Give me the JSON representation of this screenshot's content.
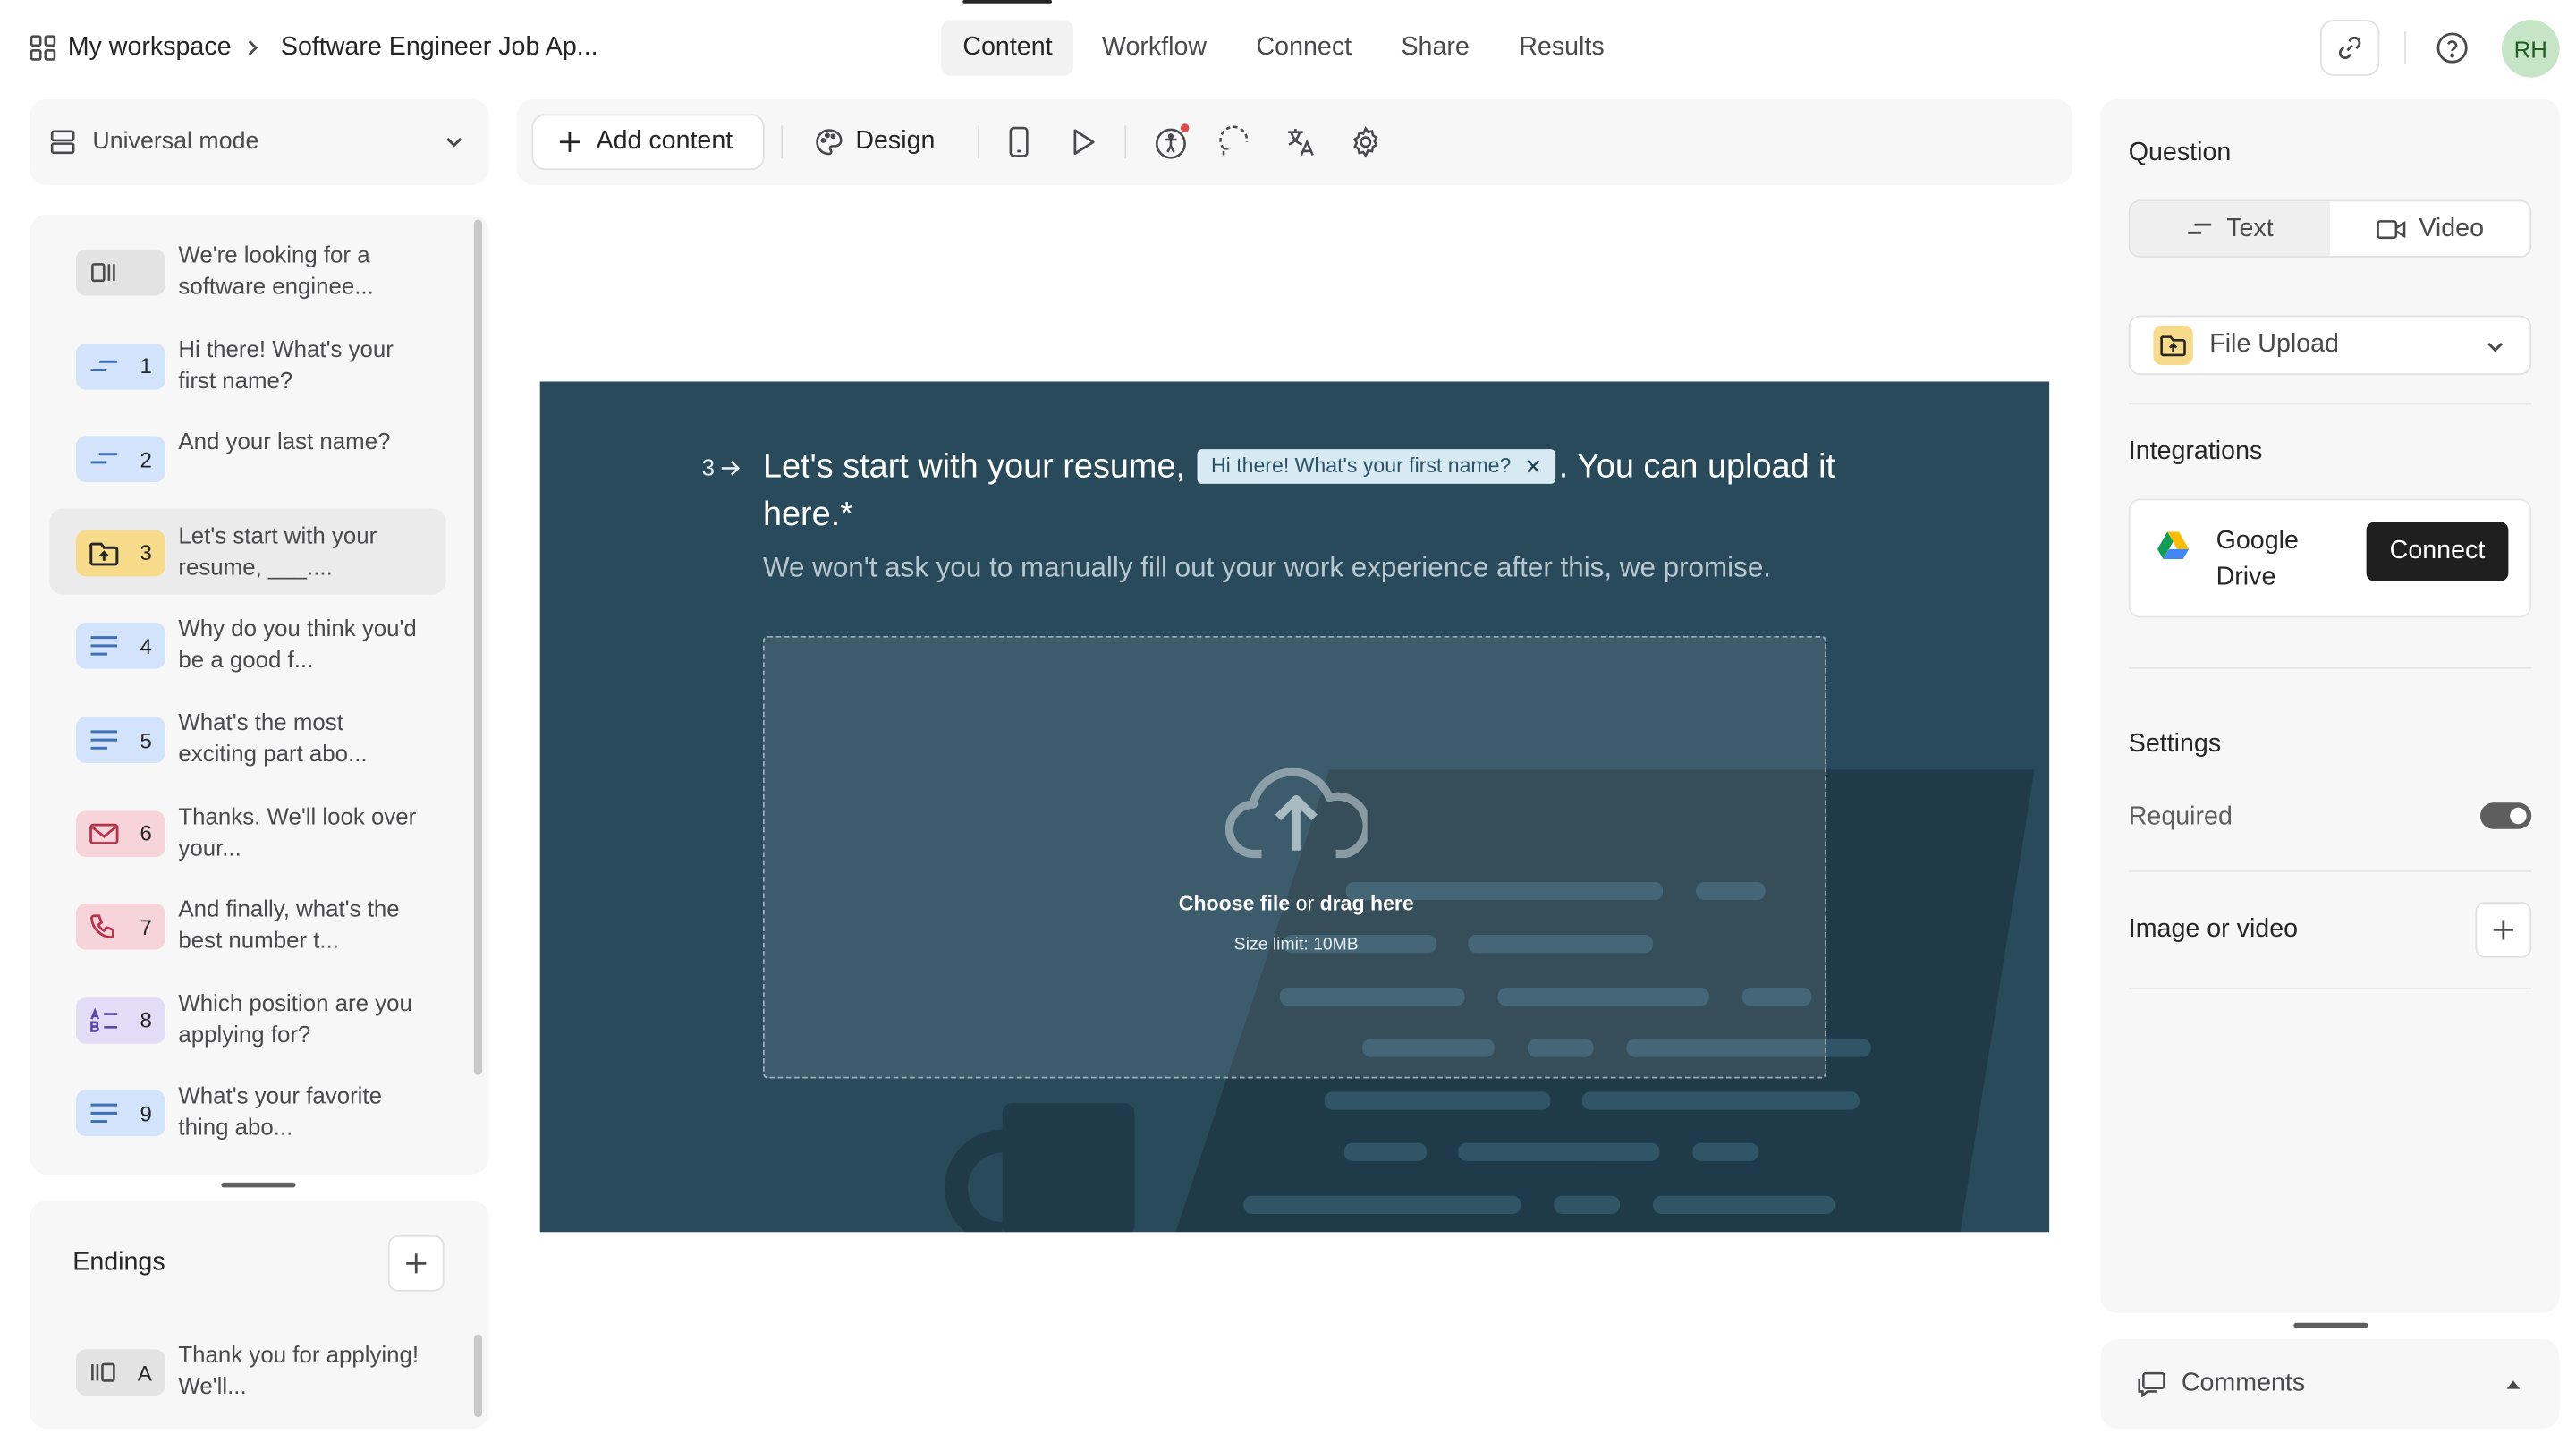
{
  "header": {
    "workspace": "My workspace",
    "form_title": "Software Engineer Job Ap...",
    "tabs": [
      {
        "label": "Content",
        "active": true
      },
      {
        "label": "Workflow",
        "active": false
      },
      {
        "label": "Connect",
        "active": false
      },
      {
        "label": "Share",
        "active": false
      },
      {
        "label": "Results",
        "active": false
      }
    ],
    "avatar_initials": "RH"
  },
  "sidebar": {
    "mode_label": "Universal mode",
    "questions": [
      {
        "num": "",
        "icon": "statement-icon",
        "color": "#e3e3e3",
        "text": "We're looking for a software enginee..."
      },
      {
        "num": "1",
        "icon": "short-text-icon",
        "color": "#d2e3fb",
        "text": "Hi there! What's your first name?"
      },
      {
        "num": "2",
        "icon": "short-text-icon",
        "color": "#d2e3fb",
        "text": "And your last name?"
      },
      {
        "num": "3",
        "icon": "file-upload-icon",
        "color": "#f7db8a",
        "text": "Let's start with your resume, ___...."
      },
      {
        "num": "4",
        "icon": "long-text-icon",
        "color": "#d2e3fb",
        "text": "Why do you think you'd be a good f..."
      },
      {
        "num": "5",
        "icon": "long-text-icon",
        "color": "#d2e3fb",
        "text": "What's the most exciting part abo..."
      },
      {
        "num": "6",
        "icon": "email-icon",
        "color": "#f6d4da",
        "text": "Thanks. We'll look over your..."
      },
      {
        "num": "7",
        "icon": "phone-icon",
        "color": "#f6d4da",
        "text": "And finally, what's the best number t..."
      },
      {
        "num": "8",
        "icon": "multiple-choice-icon",
        "color": "#e3dcf7",
        "text": "Which position are you applying for?"
      },
      {
        "num": "9",
        "icon": "long-text-icon",
        "color": "#d2e3fb",
        "text": "What's your favorite thing abo..."
      }
    ],
    "selected_index": 3,
    "endings_title": "Endings",
    "endings": [
      {
        "num": "A",
        "icon": "ending-icon",
        "color": "#e3e3e3",
        "text": "Thank you for applying! We'll..."
      }
    ]
  },
  "toolbar": {
    "add_content": "Add content",
    "design": "Design"
  },
  "preview": {
    "bg_color": "#284a5b",
    "question_number": "3",
    "title_before": "Let's start with your resume,",
    "recall_chip": "Hi there! What's your first name?",
    "title_after": ". You can upload it here.*",
    "description": "We won't ask you to manually fill out your work experience after this, we promise.",
    "choose_file": "Choose file",
    "or_text": "or",
    "drag_here": "drag here",
    "size_limit": "Size limit: 10MB"
  },
  "right_panel": {
    "question_heading": "Question",
    "segment": [
      {
        "label": "Text",
        "active": true
      },
      {
        "label": "Video",
        "active": false
      }
    ],
    "question_type": "File Upload",
    "integrations_heading": "Integrations",
    "integration_name": "Google Drive",
    "connect_label": "Connect",
    "settings_heading": "Settings",
    "required_label": "Required",
    "required_on": true,
    "image_video_label": "Image or video",
    "comments_label": "Comments"
  }
}
